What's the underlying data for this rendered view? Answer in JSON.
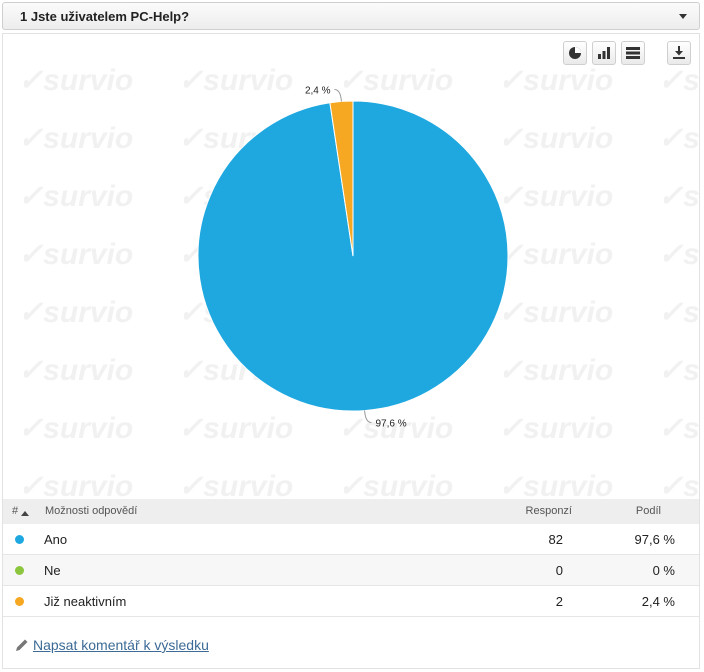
{
  "header": {
    "title": "1 Jste uživatelem PC-Help?"
  },
  "watermark_text": "survio",
  "toolbar": [
    "pie-chart-icon",
    "bar-chart-icon",
    "table-icon",
    "download-icon"
  ],
  "chart_data": {
    "type": "pie",
    "categories": [
      "Ano",
      "Ne",
      "Již neaktivním"
    ],
    "values": [
      82,
      0,
      2
    ],
    "colors": [
      "#1fa8e0",
      "#8cc63f",
      "#f7a823"
    ],
    "labels": [
      "97,6 %",
      "0 %",
      "2,4 %"
    ]
  },
  "table": {
    "columns": {
      "num": "#",
      "options": "Možnosti odpovědí",
      "responses": "Responzí",
      "share": "Podíl"
    },
    "rows": [
      {
        "label": "Ano",
        "count": "82",
        "pct": "97,6 %"
      },
      {
        "label": "Ne",
        "count": "0",
        "pct": "0 %"
      },
      {
        "label": "Již neaktivním",
        "count": "2",
        "pct": "2,4 %"
      }
    ]
  },
  "comment_link": "Napsat komentář k výsledku"
}
